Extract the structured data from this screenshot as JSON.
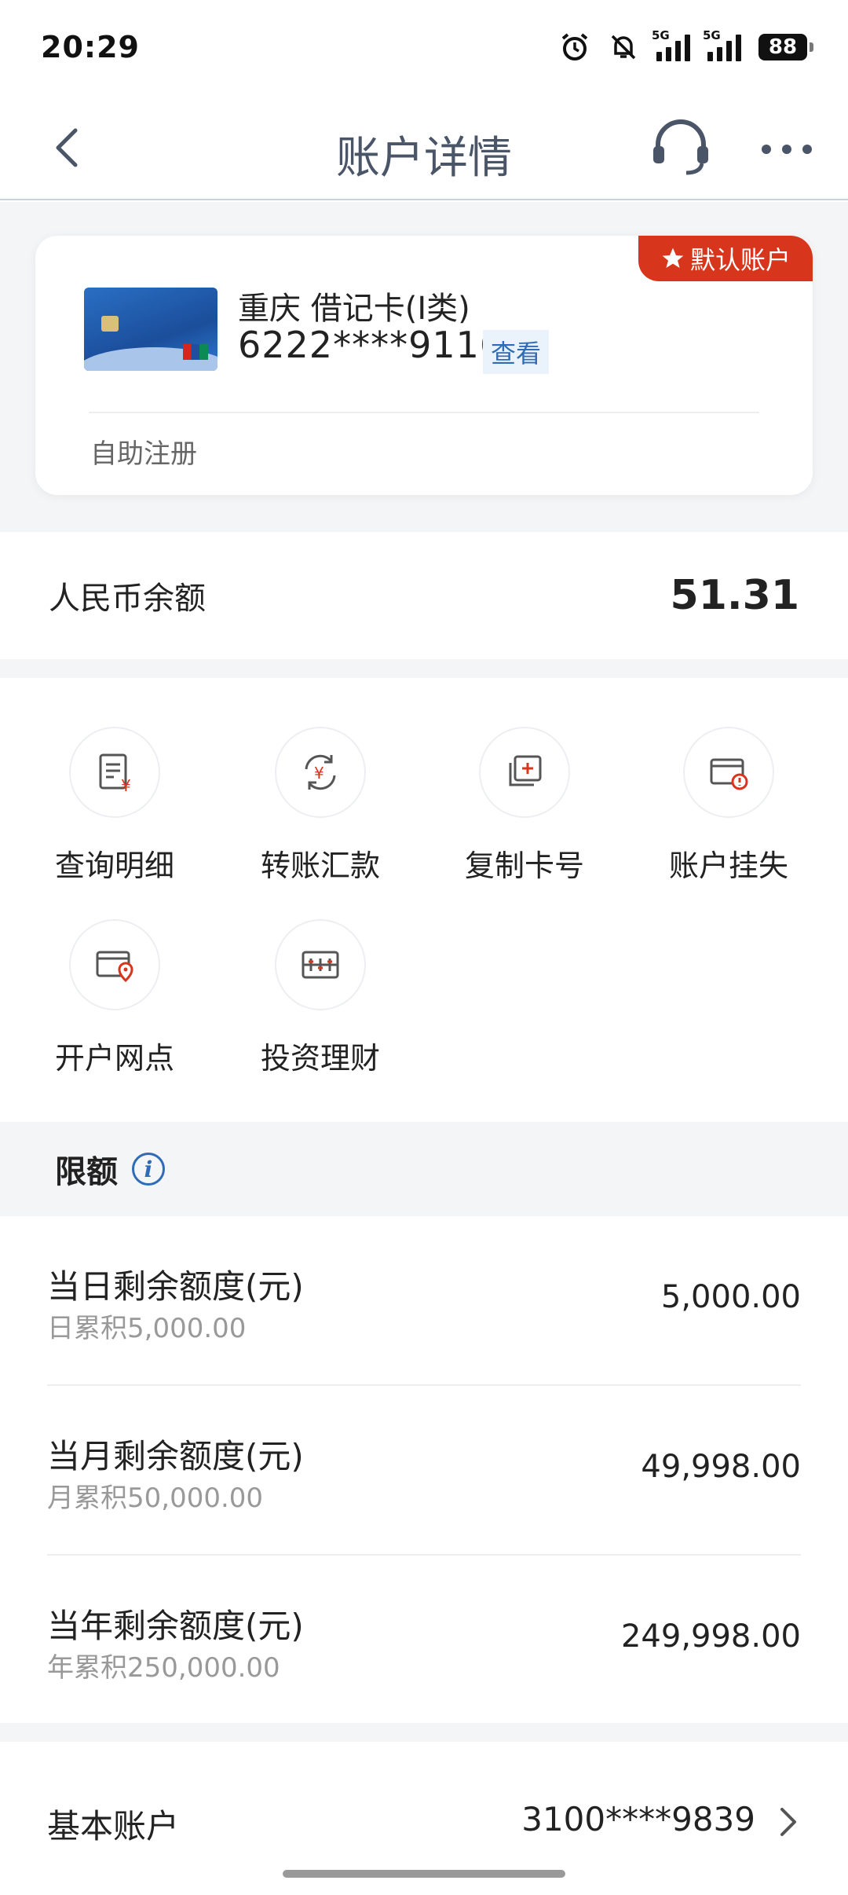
{
  "status_bar": {
    "time": "20:29",
    "network1": "5G",
    "network2": "5G",
    "battery": "88",
    "icons": [
      "alarm-icon",
      "mute-bell-icon",
      "signal-icon",
      "signal-icon",
      "battery-icon"
    ]
  },
  "nav": {
    "title": "账户详情",
    "icons": [
      "back-arrow-icon",
      "headset-service-icon",
      "more-dots-icon"
    ]
  },
  "card": {
    "badge": "默认账户",
    "name": "重庆 借记卡(I类)",
    "number": "6222****9116",
    "view_label": "查看",
    "footer": "自助注册"
  },
  "balance": {
    "label": "人民币余额",
    "value": "51.31"
  },
  "functions": [
    {
      "label": "查询明细",
      "icon": "statement-icon"
    },
    {
      "label": "转账汇款",
      "icon": "transfer-icon"
    },
    {
      "label": "复制卡号",
      "icon": "copy-card-icon"
    },
    {
      "label": "账户挂失",
      "icon": "report-loss-icon"
    },
    {
      "label": "开户网点",
      "icon": "branch-location-icon"
    },
    {
      "label": "投资理财",
      "icon": "investment-icon"
    }
  ],
  "limits": {
    "title": "限额",
    "rows": [
      {
        "name": "当日剩余额度(元)",
        "sub": "日累积5,000.00",
        "value": "5,000.00"
      },
      {
        "name": "当月剩余额度(元)",
        "sub": "月累积50,000.00",
        "value": "49,998.00"
      },
      {
        "name": "当年剩余额度(元)",
        "sub": "年累积250,000.00",
        "value": "249,998.00"
      }
    ]
  },
  "basic_account": {
    "label": "基本账户",
    "value": "3100****9839"
  },
  "colors": {
    "accent_red": "#d8351d",
    "link_blue": "#2f6cb5",
    "background_gray": "#f4f5f7"
  }
}
